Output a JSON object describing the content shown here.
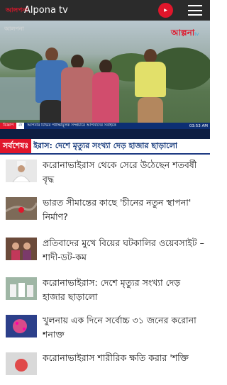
{
  "appbar": {
    "logo_text": "আলপনা",
    "title": "Alpona tv",
    "youtube_label": "YouTube"
  },
  "video": {
    "channel_logo": "আলপনা",
    "brand": "আল্পনা",
    "brand_suffix": "tv",
    "ticker_tag": "বিজ্ঞাপ",
    "ticker_tag2": "দে",
    "ticker_text": "আপনার টিভির পরীক্ষামূলক সম্প্রচারে আপনাদের সবাইকে",
    "ticker_time": "03:53 AM"
  },
  "breaking": {
    "label": "সর্বশেষঃ",
    "text": "ইরাস: দেশে মৃত্যুর সংখ্যা দেড় হাজার ছাড়ালো"
  },
  "news": [
    {
      "title": "করোনাভাইরাস থেকে সেরে উঠেছেন শতবর্ষী বৃদ্ধ",
      "thumb": "elderly"
    },
    {
      "title": "ভারত সীমান্তের কাছে 'চীনের নতুন স্থাপনা' নির্মাণ?",
      "thumb": "aerial"
    },
    {
      "title": "প্রতিবাদের মুখে বিয়ের ঘটকালির ওয়েবসাইট – শাদী-ডট-কম",
      "thumb": "people"
    },
    {
      "title": "করোনাভাইরাস: দেশে মৃত্যুর সংখ্যা দেড় হাজার ছাড়ালো",
      "thumb": "medics"
    },
    {
      "title": "খুলনায় এক দিনে সর্বোচ্চ ৩১ জনের করোনা শনাক্ত",
      "thumb": "virus"
    },
    {
      "title": "করোনাভাইরাস শারীরিক ক্ষতি করার 'শক্তি",
      "thumb": "covid"
    }
  ],
  "colors": {
    "accent_red": "#e0162b",
    "navy": "#1e3a82",
    "appbar": "#2b2b2b"
  }
}
